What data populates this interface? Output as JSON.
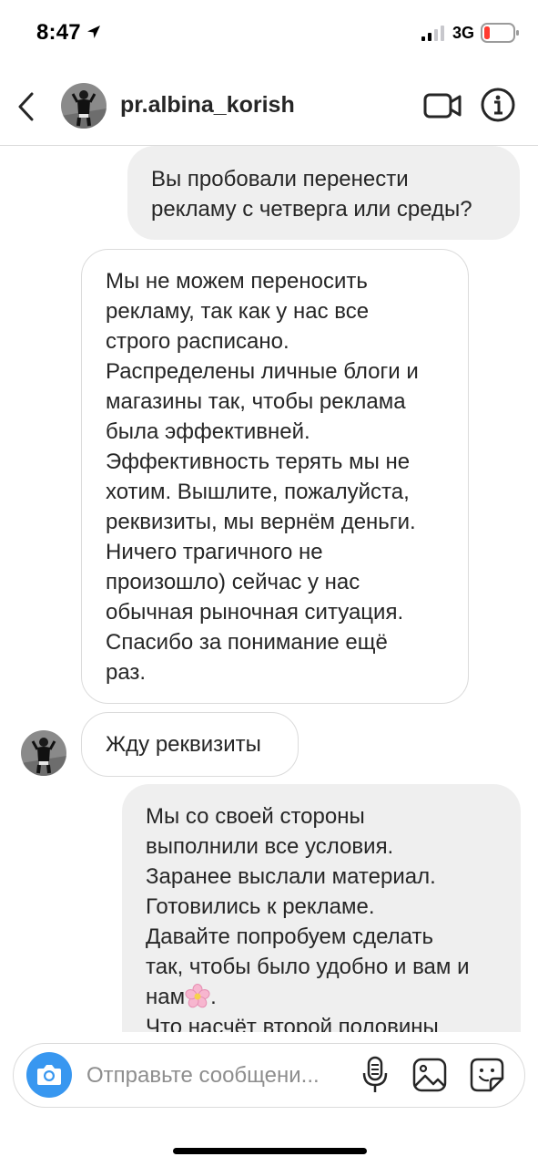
{
  "status_bar": {
    "time": "8:47",
    "network": "3G"
  },
  "header": {
    "username": "pr.albina_korish"
  },
  "messages": [
    {
      "id": "m1",
      "direction": "outgoing",
      "lines": [
        "Вы пробовали перенести",
        "рекламу с четверга или среды?"
      ]
    },
    {
      "id": "m2",
      "direction": "incoming",
      "lines": [
        "Мы не можем переносить",
        "рекламу, так как у нас все",
        "строго расписано.",
        "Распределены личные блоги и",
        "магазины так, чтобы реклама",
        "была эффективней.",
        "Эффективность терять мы не",
        "хотим. Вышлите, пожалуйста,",
        "реквизиты, мы вернём деньги.",
        "Ничего трагичного не",
        "произошло) сейчас у нас",
        "обычная рыночная ситуация.",
        "Спасибо за понимание ещё",
        "раз."
      ]
    },
    {
      "id": "m3",
      "direction": "incoming",
      "lines": [
        "Жду реквизиты"
      ]
    },
    {
      "id": "m4",
      "direction": "outgoing",
      "lines": [
        "Мы со своей стороны",
        "выполнили все условия.",
        "Заранее выслали материал.",
        "Готовились к рекламе.",
        "Давайте попробуем сделать",
        "так, чтобы было удобно и вам и",
        "нам",
        "Что насчёт второй половины"
      ],
      "emoji": "cherry-blossom"
    }
  ],
  "composer": {
    "placeholder": "Отправьте сообщени..."
  },
  "colors": {
    "accent": "#3897f0",
    "outgoing_bubble": "#efefef",
    "border": "#dbdbdb",
    "battery_low": "#ff3b30"
  }
}
